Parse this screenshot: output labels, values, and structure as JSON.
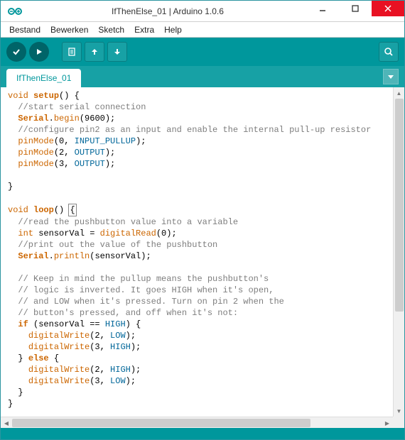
{
  "window": {
    "title": "IfThenElse_01 | Arduino 1.0.6"
  },
  "menu": {
    "items": [
      "Bestand",
      "Bewerken",
      "Sketch",
      "Extra",
      "Help"
    ]
  },
  "tab": {
    "name": "IfThenElse_01"
  },
  "code": {
    "l1_a": "void",
    "l1_b": "setup",
    "l1_c": "() {",
    "l2": "  //start serial connection",
    "l3_a": "  ",
    "l3_b": "Serial",
    "l3_c": "begin",
    "l3_d": "(9600);",
    "l4": "  //configure pin2 as an input and enable the internal pull-up resistor",
    "l5_a": "  ",
    "l5_b": "pinMode",
    "l5_c": "(0, ",
    "l5_d": "INPUT_PULLUP",
    "l5_e": ");",
    "l6_a": "  ",
    "l6_b": "pinMode",
    "l6_c": "(2, ",
    "l6_d": "OUTPUT",
    "l6_e": ");",
    "l7_a": "  ",
    "l7_b": "pinMode",
    "l7_c": "(3, ",
    "l7_d": "OUTPUT",
    "l7_e": ");",
    "l8": " ",
    "l9": "}",
    "l10": " ",
    "l11_a": "void",
    "l11_b": "loop",
    "l11_c": "() ",
    "l11_d": "{",
    "l12": "  //read the pushbutton value into a variable",
    "l13_a": "  ",
    "l13_b": "int",
    "l13_c": " sensorVal = ",
    "l13_d": "digitalRead",
    "l13_e": "(0);",
    "l14": "  //print out the value of the pushbutton",
    "l15_a": "  ",
    "l15_b": "Serial",
    "l15_c": "println",
    "l15_d": "(sensorVal);",
    "l16": " ",
    "l17": "  // Keep in mind the pullup means the pushbutton's",
    "l18": "  // logic is inverted. It goes HIGH when it's open,",
    "l19": "  // and LOW when it's pressed. Turn on pin 2 when the",
    "l20": "  // button's pressed, and off when it's not:",
    "l21_a": "  ",
    "l21_b": "if",
    "l21_c": " (sensorVal == ",
    "l21_d": "HIGH",
    "l21_e": ") {",
    "l22_a": "    ",
    "l22_b": "digitalWrite",
    "l22_c": "(2, ",
    "l22_d": "LOW",
    "l22_e": ");",
    "l23_a": "    ",
    "l23_b": "digitalWrite",
    "l23_c": "(3, ",
    "l23_d": "HIGH",
    "l23_e": ");",
    "l24_a": "  } ",
    "l24_b": "else",
    "l24_c": " {",
    "l25_a": "    ",
    "l25_b": "digitalWrite",
    "l25_c": "(2, ",
    "l25_d": "HIGH",
    "l25_e": ");",
    "l26_a": "    ",
    "l26_b": "digitalWrite",
    "l26_c": "(3, ",
    "l26_d": "LOW",
    "l26_e": ");",
    "l27": "  }",
    "l28": "}",
    "dot": "."
  }
}
